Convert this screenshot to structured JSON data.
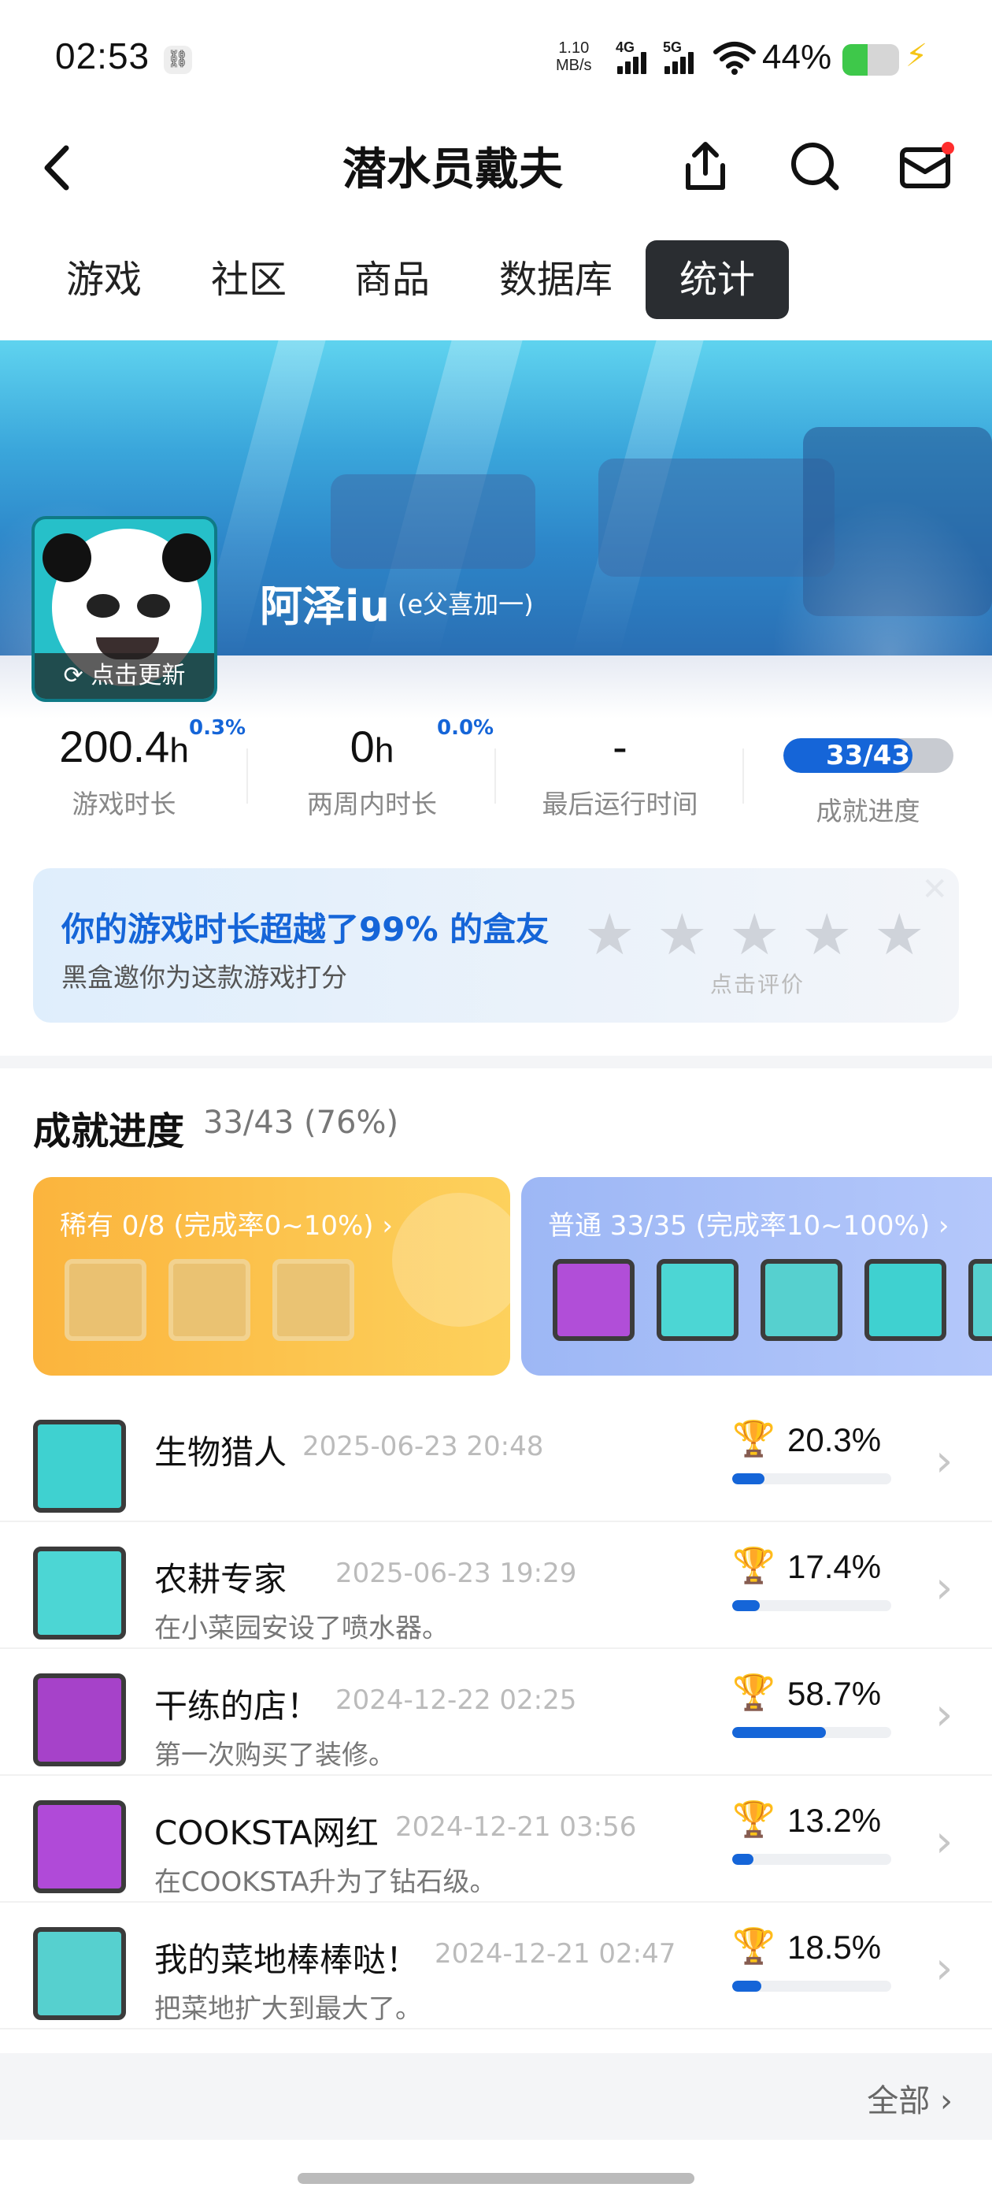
{
  "status_bar": {
    "time": "02:53",
    "nfc_icon": "link-icon",
    "speed_value": "1.10",
    "speed_unit": "MB/s",
    "sig1": "4G",
    "sig2": "5G",
    "battery": "44%",
    "battery_level": 0.44
  },
  "nav": {
    "title": "潜水员戴夫",
    "icons": [
      "back-arrow-icon",
      "share-icon",
      "search-icon",
      "mail-icon"
    ]
  },
  "tabs": [
    {
      "label": "游戏"
    },
    {
      "label": "社区"
    },
    {
      "label": "商品"
    },
    {
      "label": "数据库"
    },
    {
      "label": "统计"
    }
  ],
  "profile": {
    "username": "阿泽iu",
    "tag": "(e父喜加一)",
    "update_label": "点击更新"
  },
  "stats": [
    {
      "value": "200.4",
      "unit": "h",
      "pct": "0.3%",
      "label": "游戏时长"
    },
    {
      "value": "0",
      "unit": "h",
      "pct": "0.0%",
      "label": "两周内时长"
    },
    {
      "value": "-",
      "unit": "",
      "pct": "",
      "label": "最后运行时间"
    },
    {
      "value": "33/43",
      "unit": "",
      "pct": "",
      "label": "成就进度",
      "progress": 0.76
    }
  ],
  "rating": {
    "title": "你的游戏时长超越了99% 的盒友",
    "subtitle": "黑盒邀你为这款游戏打分",
    "hint": "点击评价",
    "stars": 5
  },
  "achievements_section": {
    "title": "成就进度",
    "count": "33/43 (76%)",
    "rare_label": "稀有 0/8 (完成率0~10%) ›",
    "common_label": "普通 33/35 (完成率10~100%) ›",
    "see_all": "全部 ›"
  },
  "achievements": [
    {
      "name": "生物猎人",
      "date": "2025-06-23 20:48",
      "desc": "",
      "pct": "20.3%",
      "progress": 0.203,
      "color": "#3fd1d0"
    },
    {
      "name": "农耕专家",
      "date": "2025-06-23 19:29",
      "desc": "在小菜园安设了喷水器。",
      "pct": "17.4%",
      "progress": 0.174,
      "color": "#4cd6d4"
    },
    {
      "name": "干练的店！",
      "date": "2024-12-22 02:25",
      "desc": "第一次购买了装修。",
      "pct": "58.7%",
      "progress": 0.587,
      "color": "#a642c9"
    },
    {
      "name": "COOKSTA网红",
      "date": "2024-12-21 03:56",
      "desc": "在COOKSTA升为了钻石级。",
      "pct": "13.2%",
      "progress": 0.132,
      "color": "#b04ad8"
    },
    {
      "name": "我的菜地棒棒哒！",
      "date": "2024-12-21 02:47",
      "desc": "把菜地扩大到最大了。",
      "pct": "18.5%",
      "progress": 0.185,
      "color": "#56d0cf"
    }
  ]
}
